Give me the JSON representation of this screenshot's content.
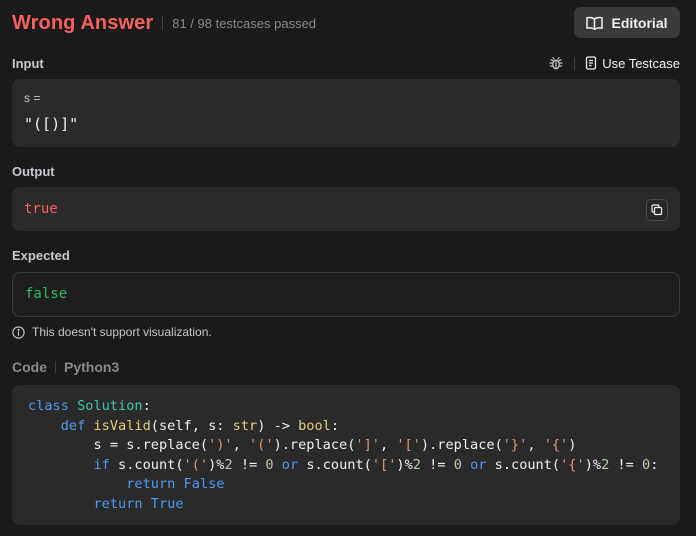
{
  "header": {
    "status": "Wrong Answer",
    "passed": "81 / 98 testcases passed",
    "editorial_label": "Editorial"
  },
  "input": {
    "label": "Input",
    "use_testcase_label": "Use Testcase",
    "var_label": "s =",
    "value": "\"([)]\""
  },
  "output": {
    "label": "Output",
    "value": "true"
  },
  "expected": {
    "label": "Expected",
    "value": "false"
  },
  "note": "This doesn't support visualization.",
  "code": {
    "label": "Code",
    "language": "Python3",
    "lines": [
      "class Solution:",
      "    def isValid(self, s: str) -> bool:",
      "        s = s.replace(')', '(').replace(']', '[').replace('}', '{')",
      "        if s.count('(')%2 != 0 or s.count('[')%2 != 0 or s.count('{')%2 != 0:",
      "            return False",
      "        return True"
    ]
  },
  "colors": {
    "wrong_answer": "#f8615c",
    "expected_ok": "#2cbb5d",
    "keyword": "#4e9cf6",
    "class_name": "#3fc8b0",
    "function_name": "#e3d276",
    "string": "#e8946b"
  },
  "icons": {
    "editorial": "book-icon",
    "debug": "bug-icon",
    "use_testcase": "document-icon",
    "copy": "copy-icon",
    "note": "info-icon"
  }
}
